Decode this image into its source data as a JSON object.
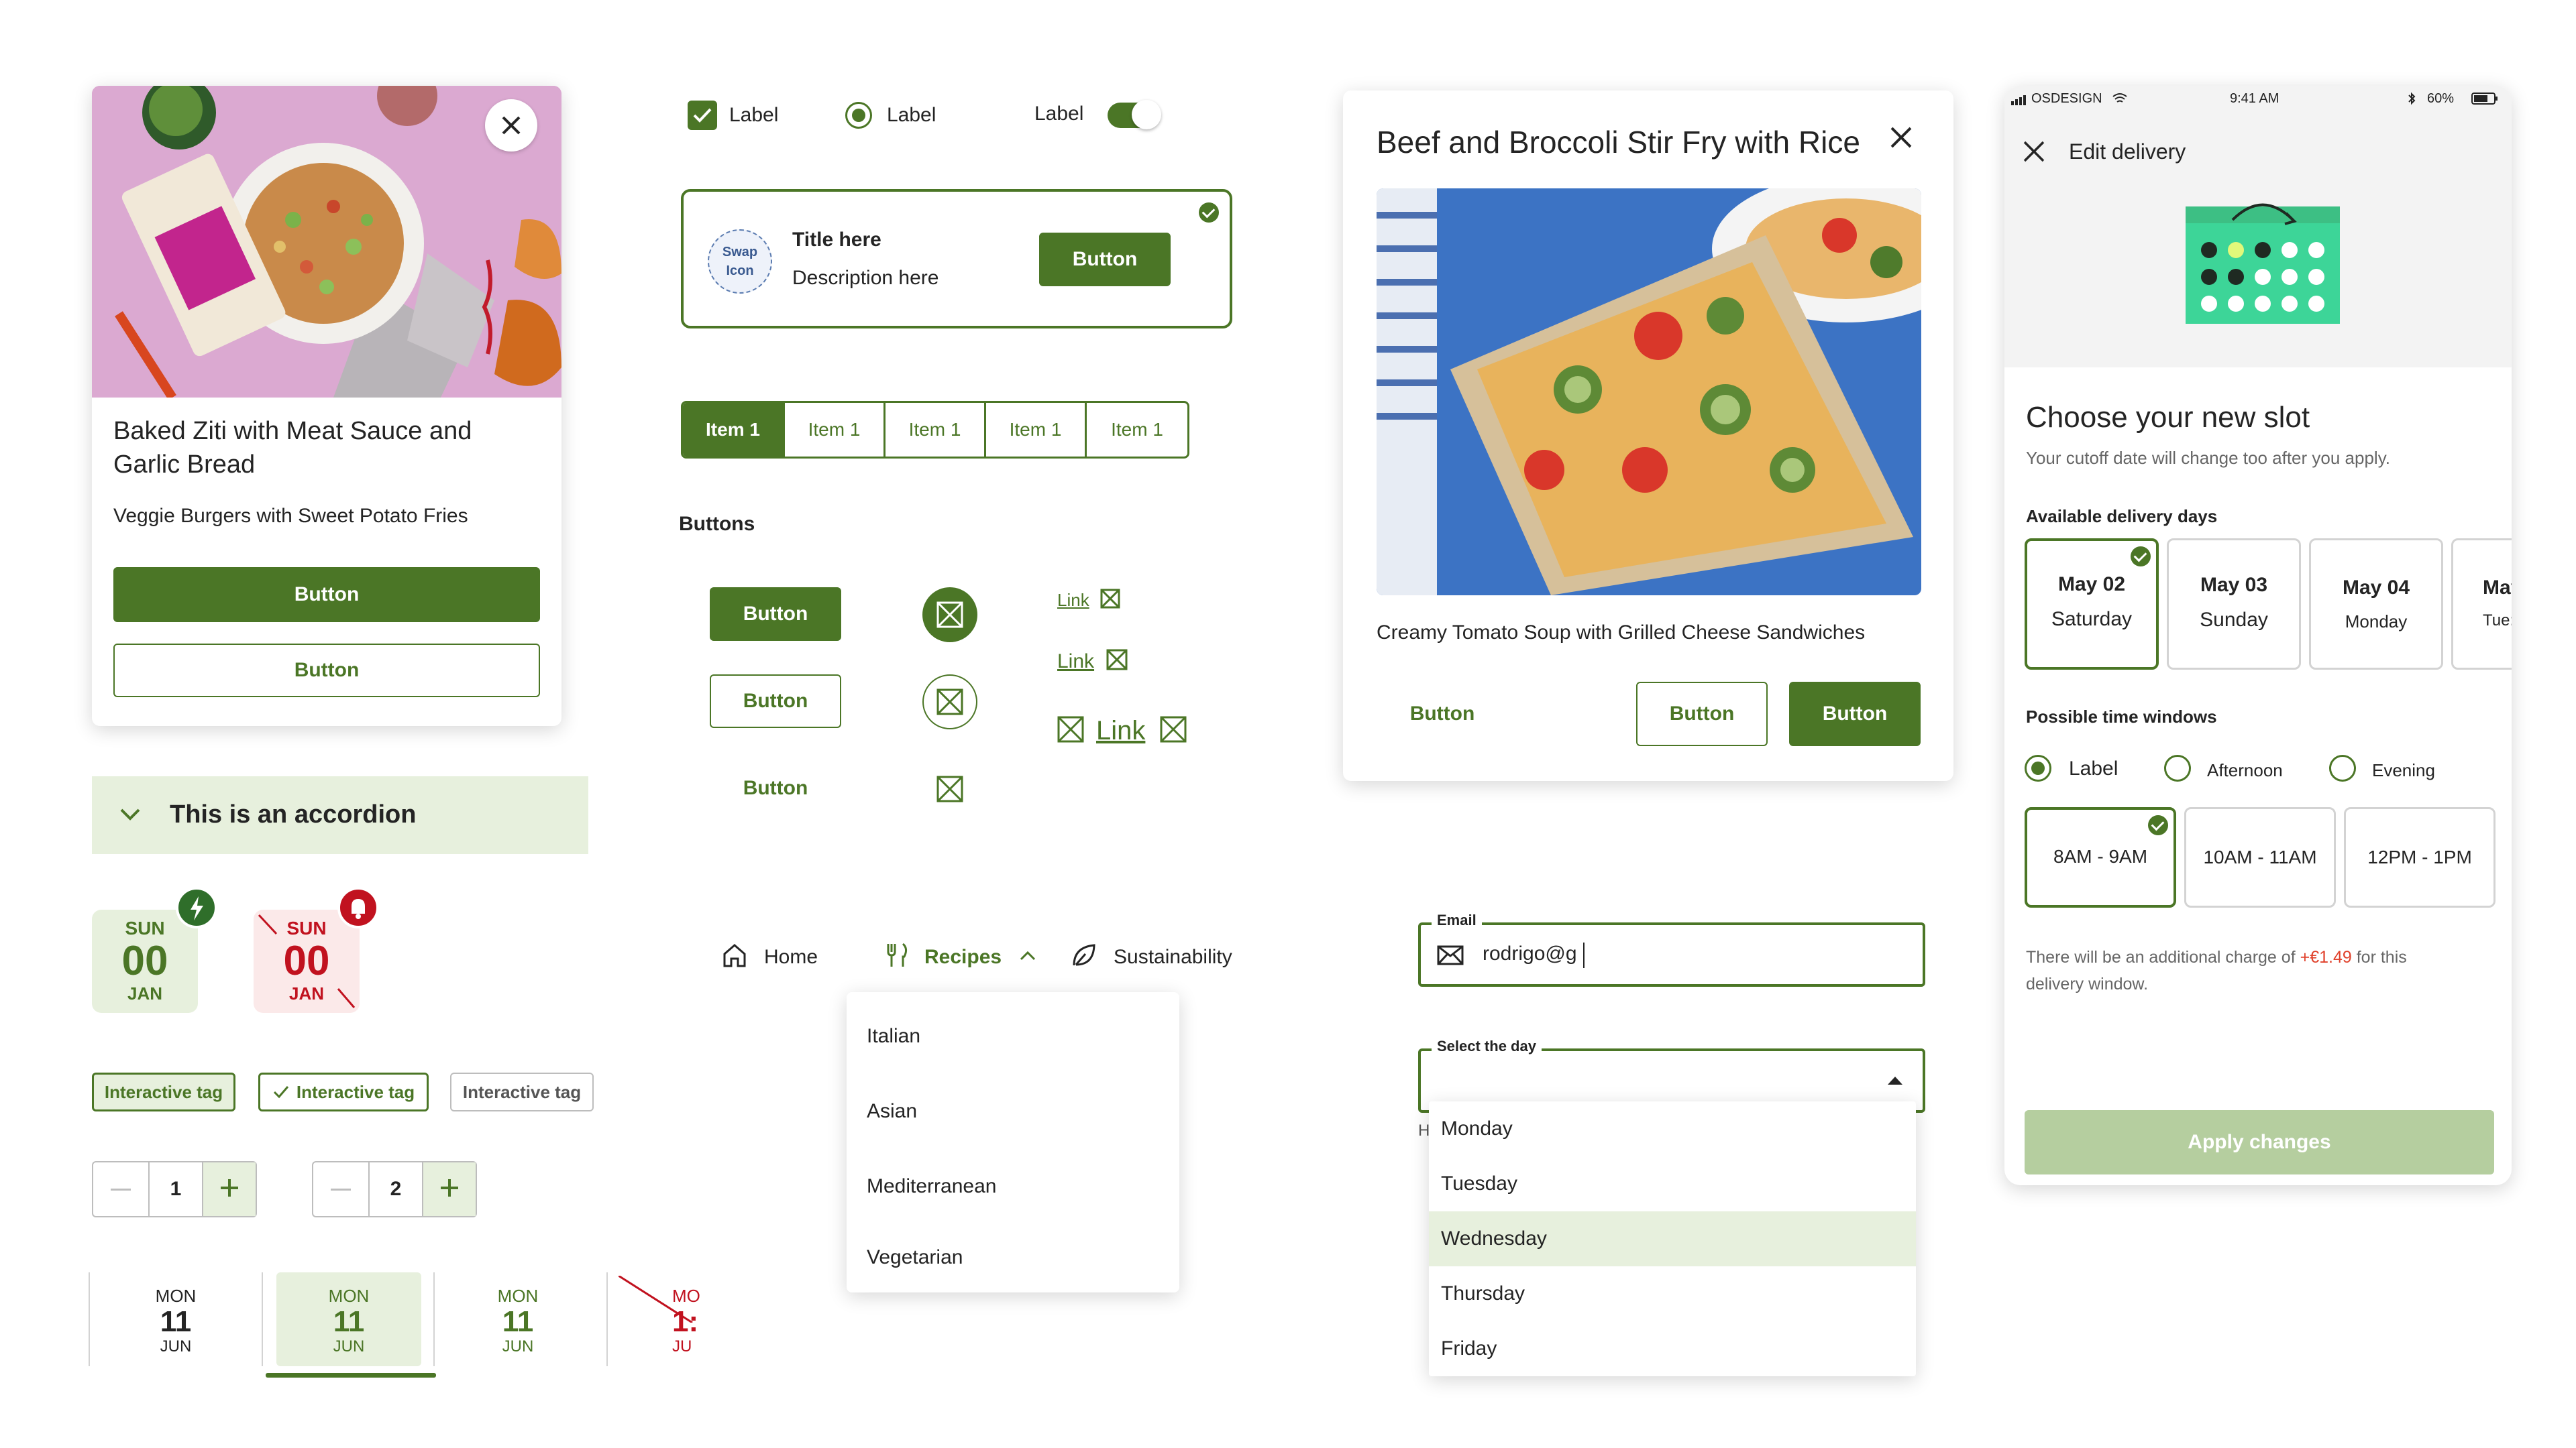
{
  "colors": {
    "brand": "#4b7626",
    "brand_light": "#e7f0dd",
    "danger": "#c1121f",
    "danger_light": "#fbe9e9",
    "mint": "#3dd598",
    "disabled": "#b5ce9f"
  },
  "product_card": {
    "title": "Baked Ziti with Meat Sauce and Garlic Bread",
    "subtitle": "Veggie Burgers with Sweet Potato Fries",
    "primary_button": "Button",
    "secondary_button": "Button",
    "close_icon": "close-icon"
  },
  "accordion": {
    "label": "This is an accordion"
  },
  "date_badges": [
    {
      "day": "SUN",
      "date": "00",
      "month": "JAN",
      "state": "active",
      "badge_icon": "lightning-icon"
    },
    {
      "day": "SUN",
      "date": "00",
      "month": "JAN",
      "state": "unavailable",
      "badge_icon": "bell-icon"
    }
  ],
  "tags": [
    {
      "label": "Interactive tag",
      "state": "filled"
    },
    {
      "label": "Interactive tag",
      "state": "checked"
    },
    {
      "label": "Interactive tag",
      "state": "default"
    }
  ],
  "steppers": [
    {
      "value": "1"
    },
    {
      "value": "2"
    }
  ],
  "day_tabs": [
    {
      "day": "MON",
      "date": "11",
      "month": "JUN",
      "state": "default"
    },
    {
      "day": "MON",
      "date": "11",
      "month": "JUN",
      "state": "selected"
    },
    {
      "day": "MON",
      "date": "11",
      "month": "JUN",
      "state": "default"
    },
    {
      "day": "MO",
      "date": "1:",
      "month": "JU",
      "state": "unavailable"
    }
  ],
  "controls": {
    "checkbox_label": "Label",
    "radio_label": "Label",
    "toggle_label": "Label"
  },
  "tile": {
    "icon_text_1": "Swap",
    "icon_text_2": "Icon",
    "title": "Title here",
    "description": "Description here",
    "button": "Button"
  },
  "segmented": {
    "items": [
      "Item 1",
      "Item 1",
      "Item 1",
      "Item 1",
      "Item 1"
    ],
    "selected_index": 0
  },
  "buttons_section": {
    "heading": "Buttons",
    "primary": "Button",
    "outline": "Button",
    "text": "Button",
    "link_small": "Link",
    "link_medium": "Link",
    "link_large": "Link"
  },
  "nav": {
    "home": "Home",
    "recipes": "Recipes",
    "sustainability": "Sustainability",
    "menu_items": [
      "Italian",
      "Asian",
      "Mediterranean",
      "Vegetarian"
    ]
  },
  "recipe_modal": {
    "title": "Beef and Broccoli Stir Fry with Rice",
    "caption": "Creamy Tomato Soup with Grilled Cheese Sandwiches",
    "text_button": "Button",
    "outline_button": "Button",
    "primary_button": "Button"
  },
  "email_field": {
    "label": "Email",
    "value": "rodrigo@g"
  },
  "select_field": {
    "label": "Select the day",
    "helper_fragment": "H",
    "options": [
      "Monday",
      "Tuesday",
      "Wednesday",
      "Thursday",
      "Friday"
    ],
    "highlighted_index": 2
  },
  "phone": {
    "status": {
      "carrier": "OSDESIGN",
      "time": "9:41 AM",
      "battery": "60%"
    },
    "header_title": "Edit delivery",
    "heading": "Choose your new slot",
    "subheading": "Your cutoff date will change too after you apply.",
    "days_label": "Available delivery days",
    "days": [
      {
        "date": "May 02",
        "weekday": "Saturday",
        "selected": true
      },
      {
        "date": "May 03",
        "weekday": "Sunday",
        "selected": false
      },
      {
        "date": "May 04",
        "weekday": "Monday",
        "selected": false
      },
      {
        "date": "May",
        "weekday": "Tue:",
        "selected": false
      }
    ],
    "windows_label": "Possible time windows",
    "window_radios": [
      {
        "label": "Label",
        "selected": true
      },
      {
        "label": "Afternoon",
        "selected": false
      },
      {
        "label": "Evening",
        "selected": false
      }
    ],
    "slots": [
      {
        "label": "8AM - 9AM",
        "selected": true
      },
      {
        "label": "10AM - 11AM",
        "selected": false
      },
      {
        "label": "12PM - 1PM",
        "selected": false
      }
    ],
    "charge_note_pre": "There will be an additional charge of",
    "charge_amount": "+€1.49",
    "charge_note_post": "for this delivery window.",
    "apply_button": "Apply changes"
  }
}
